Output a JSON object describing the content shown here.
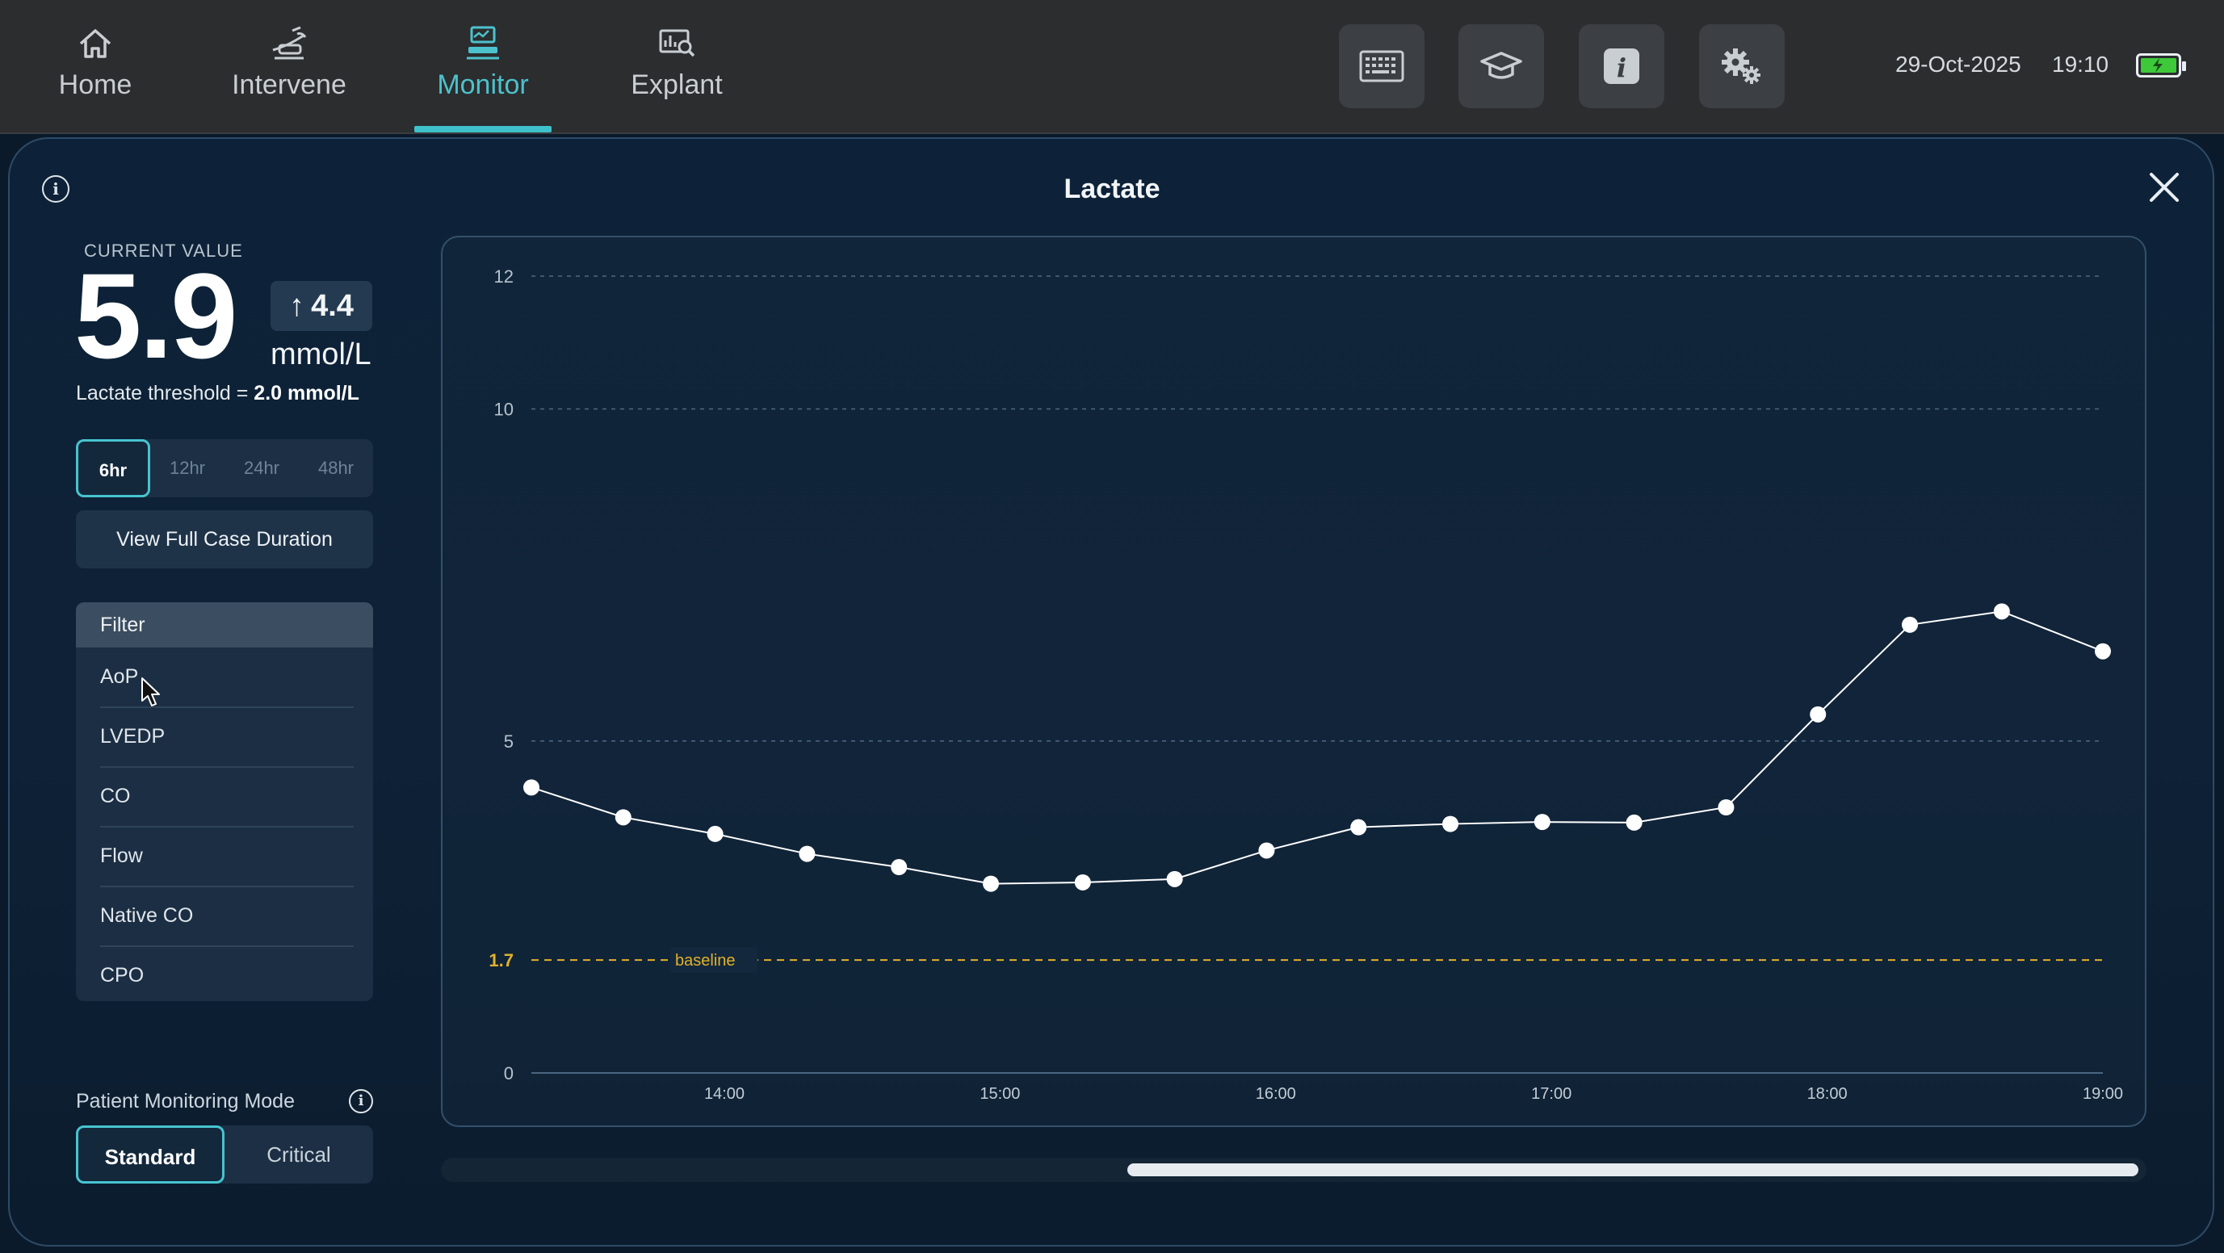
{
  "nav": {
    "items": [
      {
        "label": "Home",
        "icon": "home-icon"
      },
      {
        "label": "Intervene",
        "icon": "pump-icon"
      },
      {
        "label": "Monitor",
        "icon": "monitor-icon"
      },
      {
        "label": "Explant",
        "icon": "explant-icon"
      }
    ],
    "active": "Monitor"
  },
  "toolbar": {
    "buttons": [
      "keyboard-icon",
      "education-icon",
      "info-icon",
      "settings-icon"
    ]
  },
  "status": {
    "date": "29-Oct-2025",
    "time": "19:10",
    "battery_color": "#3ec93a"
  },
  "panel": {
    "title": "Lactate",
    "info_symbol": "i"
  },
  "current": {
    "label": "CURRENT VALUE",
    "value": "5.9",
    "delta": "4.4",
    "delta_arrow": "↑",
    "unit": "mmol/L",
    "threshold_label": "Lactate threshold = ",
    "threshold_value": "2.0 mmol/L"
  },
  "ranges": [
    "6hr",
    "12hr",
    "24hr",
    "48hr"
  ],
  "active_range": "6hr",
  "full_case_button": "View Full Case Duration",
  "filter": {
    "title": "Filter",
    "items": [
      "AoP",
      "LVEDP",
      "CO",
      "Flow",
      "Native CO",
      "CPO"
    ]
  },
  "monitoring_mode": {
    "label": "Patient Monitoring Mode",
    "options": [
      "Standard",
      "Critical"
    ],
    "active": "Standard"
  },
  "colors": {
    "accent": "#46c4cf",
    "baseline": "#e2b12b",
    "line": "#ffffff"
  },
  "chart_data": {
    "type": "line",
    "title": "Lactate",
    "ylim": [
      0,
      12
    ],
    "y_ticks": [
      0,
      5,
      10,
      12
    ],
    "x_ticks": [
      "14:00",
      "15:00",
      "16:00",
      "17:00",
      "18:00",
      "19:00"
    ],
    "x_range": [
      "13:18",
      "19:00"
    ],
    "grid": true,
    "series": [
      {
        "x": [
          "13:18",
          "13:38",
          "13:58",
          "14:18",
          "14:38",
          "14:58",
          "15:18",
          "15:38",
          "15:58",
          "16:18",
          "16:38",
          "16:58",
          "17:18",
          "17:38",
          "17:58",
          "18:18",
          "18:38",
          "19:00"
        ],
        "values": [
          4.3,
          3.85,
          3.6,
          3.3,
          3.1,
          2.85,
          2.87,
          2.92,
          3.35,
          3.7,
          3.75,
          3.78,
          3.77,
          4.0,
          5.4,
          6.75,
          6.95,
          6.35
        ]
      }
    ],
    "baseline": {
      "value": 1.7,
      "label": "baseline",
      "tick_label": "1.7"
    }
  }
}
